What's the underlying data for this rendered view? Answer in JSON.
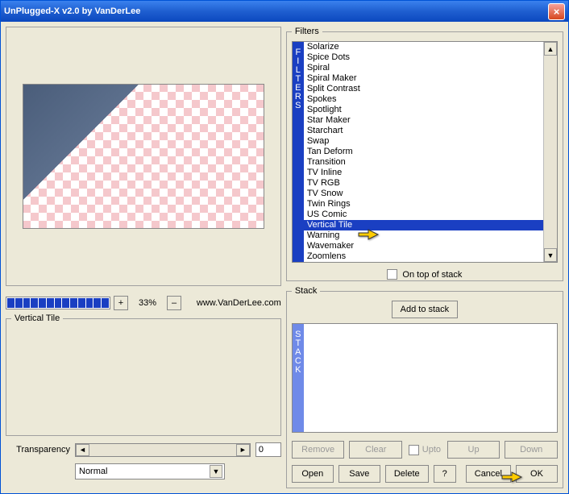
{
  "titlebar": {
    "title": "UnPlugged-X v2.0 by VanDerLee"
  },
  "zoom": {
    "plus": "+",
    "value": "33%",
    "minus": "–",
    "link": "www.VanDerLee.com"
  },
  "leftGroup": {
    "legend": "Vertical Tile"
  },
  "transparency": {
    "label": "Transparency",
    "value": "0"
  },
  "mode": {
    "label": "Normal"
  },
  "filters": {
    "legend": "Filters",
    "sidelabel": [
      "F",
      "I",
      "L",
      "T",
      "E",
      "R",
      "S"
    ],
    "items": [
      "Solarize",
      "Spice Dots",
      "Spiral",
      "Spiral Maker",
      "Split Contrast",
      "Spokes",
      "Spotlight",
      "Star Maker",
      "Starchart",
      "Swap",
      "Tan Deform",
      "Transition",
      "TV Inline",
      "TV RGB",
      "TV Snow",
      "Twin Rings",
      "US Comic",
      "Vertical Tile",
      "Warning",
      "Wavemaker",
      "Zoomlens"
    ],
    "selectedIndex": 17,
    "ontop": "On top of stack"
  },
  "stack": {
    "legend": "Stack",
    "sidelabel": [
      "S",
      "T",
      "A",
      "C",
      "K"
    ],
    "add": "Add to stack",
    "remove": "Remove",
    "clear": "Clear",
    "upto": "Upto",
    "up": "Up",
    "down": "Down"
  },
  "bottom": {
    "open": "Open",
    "save": "Save",
    "delete": "Delete",
    "help": "?",
    "cancel": "Cancel",
    "ok": "OK"
  }
}
